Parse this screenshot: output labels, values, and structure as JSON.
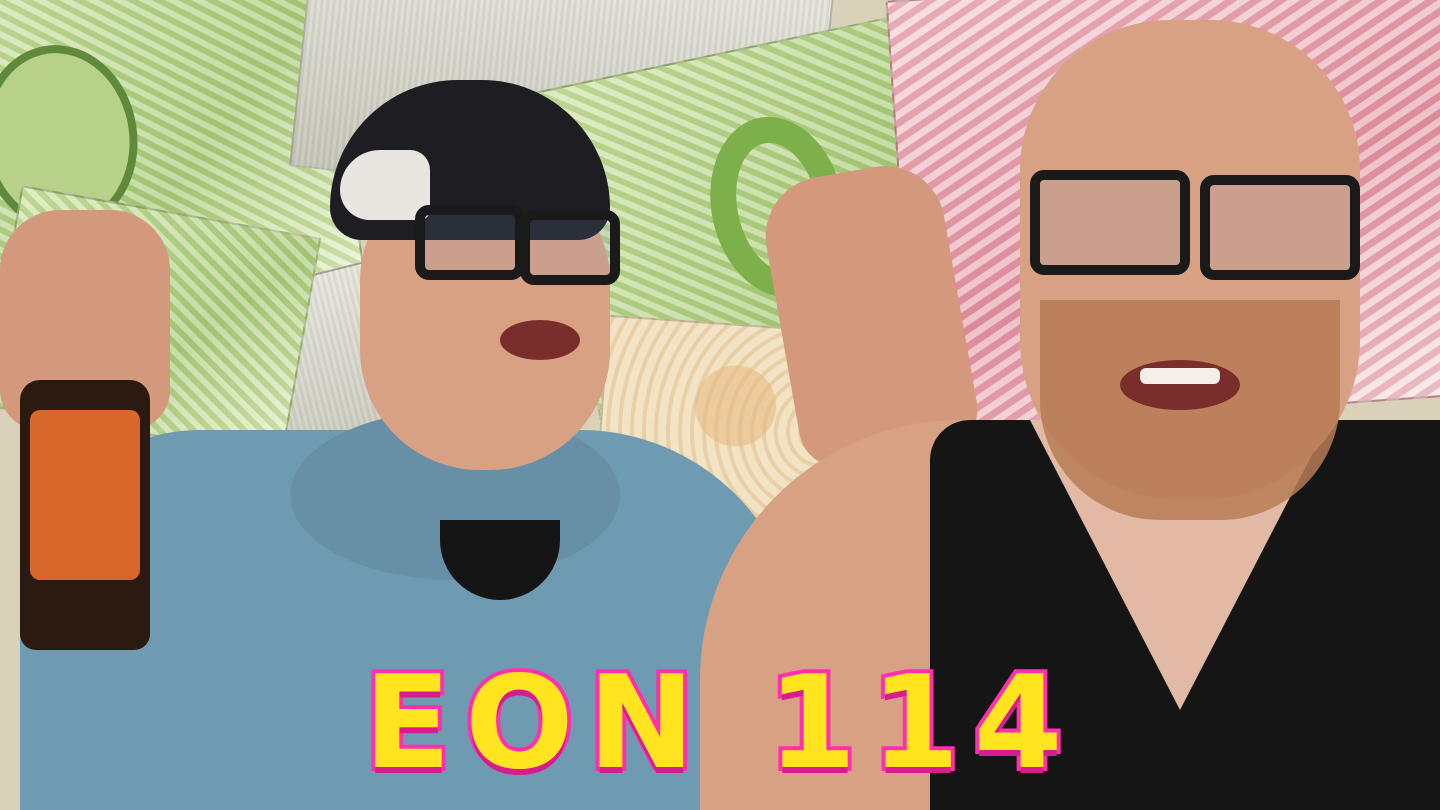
{
  "title": "EON 114",
  "colors": {
    "title_fill": "#ffe41f",
    "title_stroke": "#ff2fb0",
    "background_banknotes_green": "#a8c978",
    "background_banknotes_red": "#e39aa7",
    "hoodie": "#6f9bb2",
    "tank_top": "#151515"
  },
  "scene": {
    "background": "banknote-collage",
    "left_person": "man-in-cap-and-glasses-with-bottle",
    "right_person": "man-with-glasses-and-beard"
  }
}
